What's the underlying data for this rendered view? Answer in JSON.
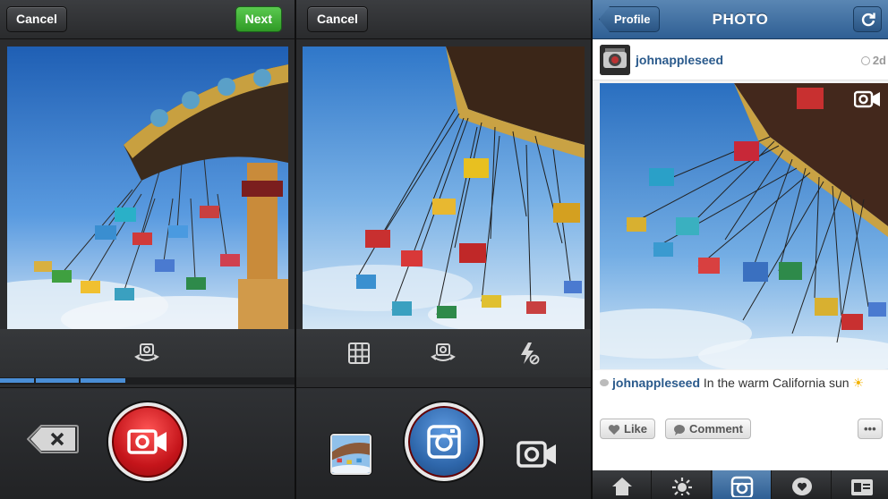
{
  "panel1": {
    "cancel_label": "Cancel",
    "next_label": "Next",
    "progress_fraction": 0.43
  },
  "panel2": {
    "cancel_label": "Cancel"
  },
  "panel3": {
    "nav": {
      "back_label": "Profile",
      "title": "PHOTO"
    },
    "post": {
      "username": "johnappleseed",
      "time": "2d",
      "caption_user": "johnappleseed",
      "caption_text": "In the warm California sun",
      "caption_emoji": "☀"
    },
    "actions": {
      "like_label": "Like",
      "comment_label": "Comment",
      "more_label": "•••"
    }
  },
  "colors": {
    "record_red": "#c4141a",
    "shutter_blue": "#2e66aa",
    "next_green": "#2f9a25",
    "nav_blue": "#2f5f94",
    "progress_blue": "#4a8ed6",
    "link_blue": "#2a5a8c"
  },
  "icons": [
    "flip-camera-icon",
    "delete-icon",
    "video-camera-icon",
    "grid-icon",
    "flash-off-icon",
    "instagram-camera-icon",
    "refresh-icon",
    "heart-icon",
    "comment-icon",
    "home-icon",
    "explore-icon",
    "profile-icon"
  ]
}
